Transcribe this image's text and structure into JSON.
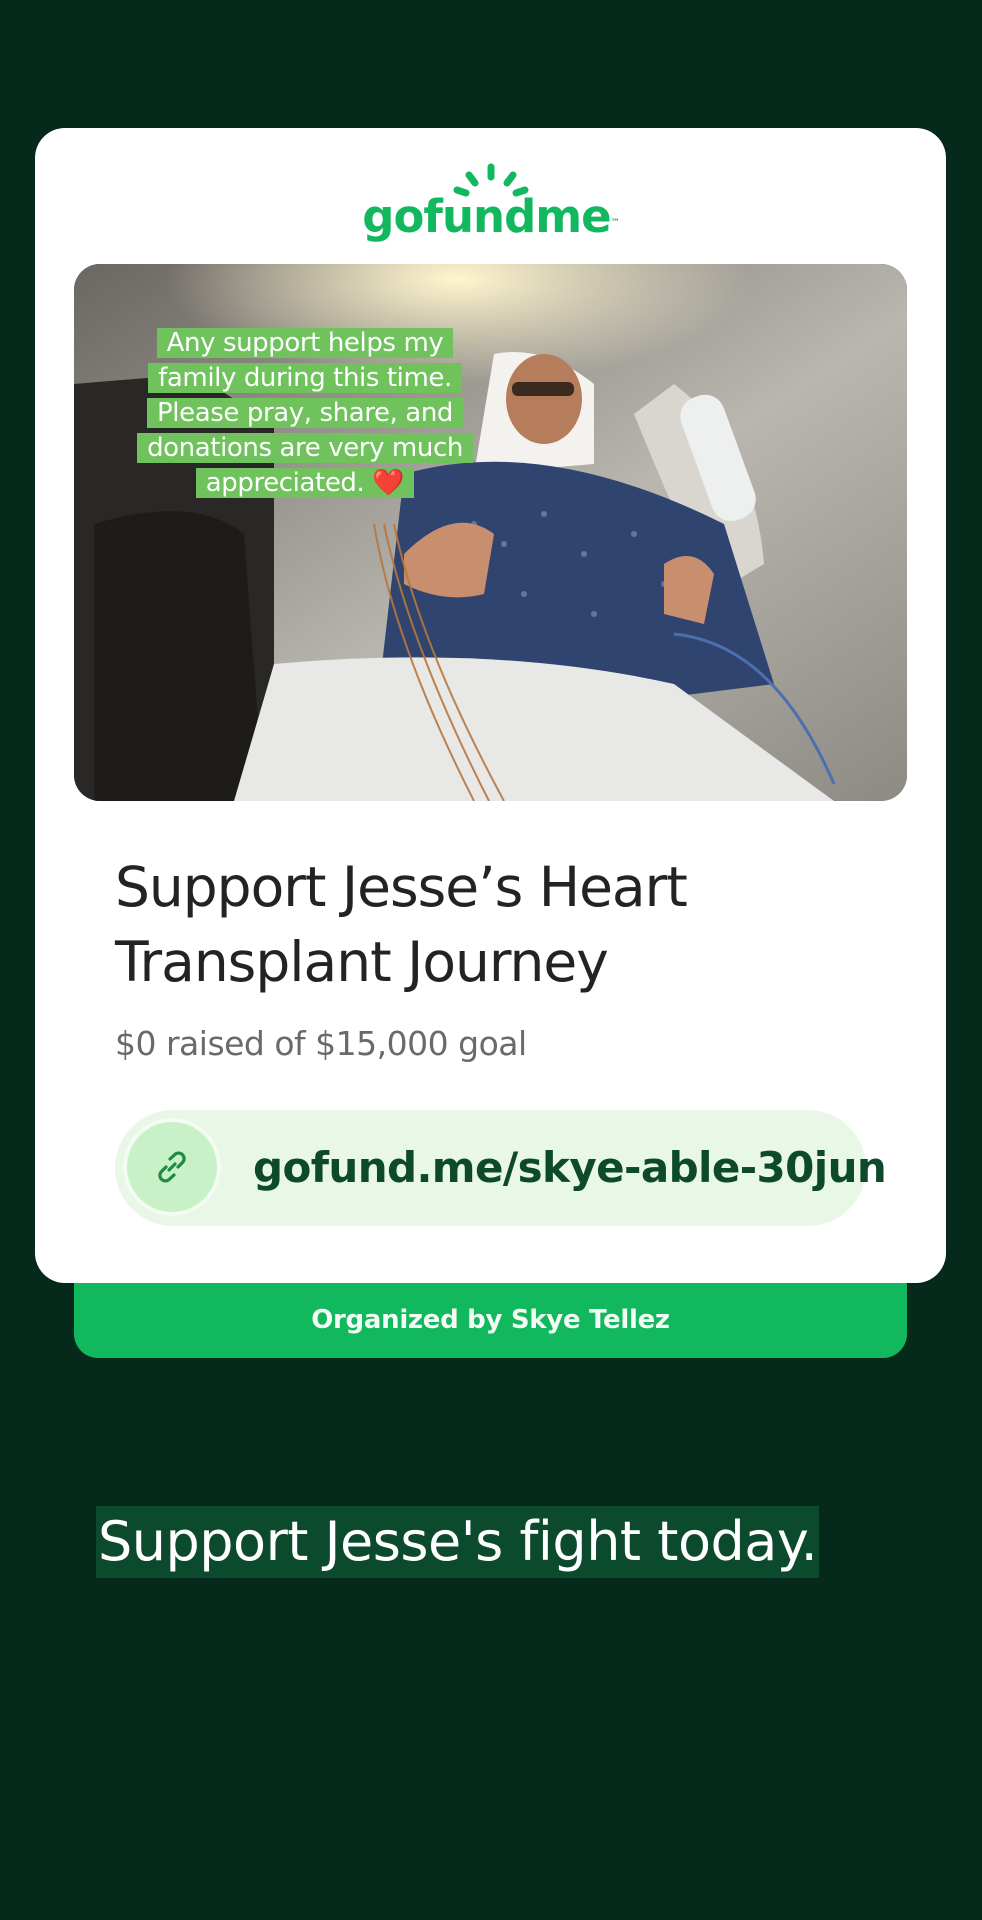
{
  "brand": {
    "logo_text": "gofundme",
    "logo_tm": "™",
    "color": "#12b85e"
  },
  "photo": {
    "caption_lines": [
      "Any support helps my",
      "family during this time.",
      "Please pray, share, and",
      "donations are very much",
      "appreciated. ❤️"
    ]
  },
  "campaign": {
    "title": "Support Jesse’s Heart Transplant Journey",
    "raised_text": "$0 raised of $15,000 goal",
    "link_text": "gofund.me/skye-able-30jun",
    "organizer_text": "Organized by Skye Tellez"
  },
  "overlay": {
    "bottom_caption": "Support Jesse's fight today."
  },
  "icons": {
    "link": "link-icon",
    "logo": "sun-rays-icon"
  },
  "colors": {
    "background": "#05291a",
    "card": "#ffffff",
    "accent": "#12b85e",
    "link_pill": "#e9f7e6",
    "caption_highlight": "#0b4a2d",
    "photo_caption_highlight": "#6fc25c"
  }
}
